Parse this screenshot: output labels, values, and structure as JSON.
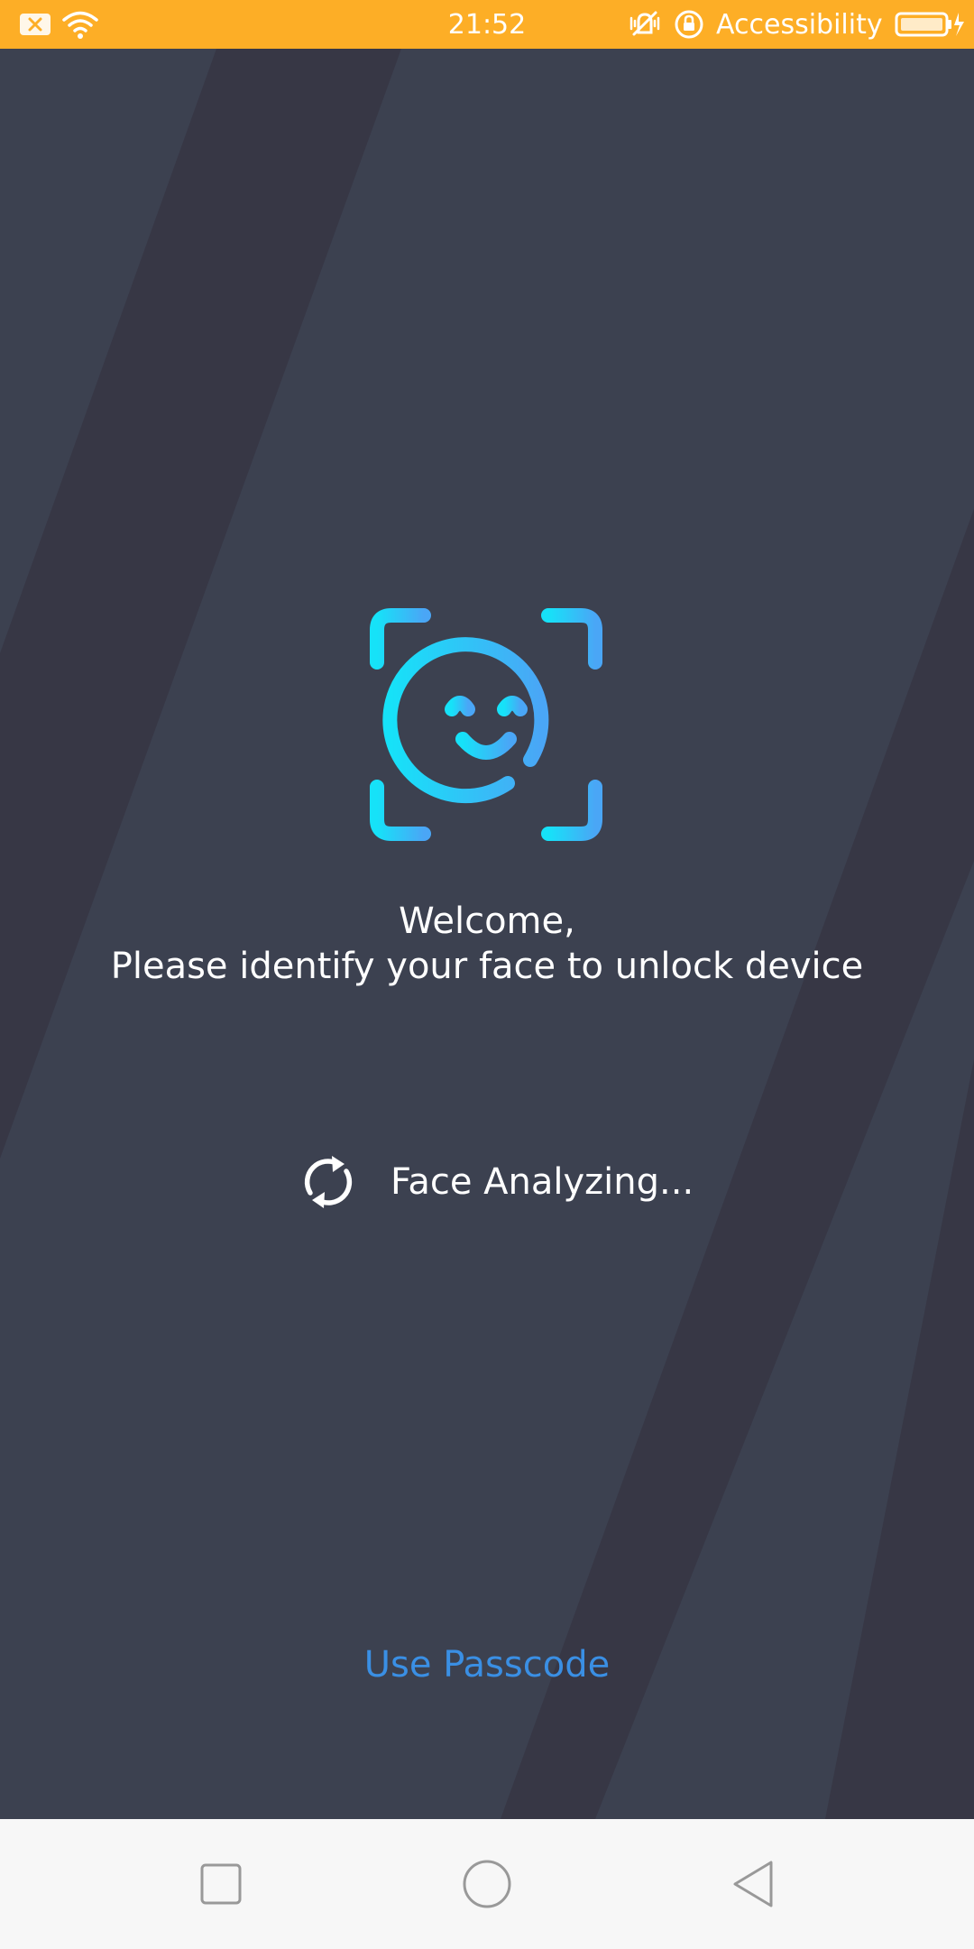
{
  "status_bar": {
    "time": "21:52",
    "right_label": "Accessibility",
    "background": "#fdae26"
  },
  "main": {
    "welcome_line1": "Welcome,",
    "welcome_line2": "Please identify your face to unlock device",
    "analyzing_label": "Face Analyzing...",
    "passcode_label": "Use Passcode"
  },
  "icons": {
    "face_scan": "face-scan-icon",
    "refresh": "refresh-icon"
  },
  "colors": {
    "background": "#3c4150",
    "band": "#373745",
    "accent_cyan": "#16e2f8",
    "accent_blue": "#4aa6f6",
    "link": "#3a8fe4",
    "nav_background": "#f7f7f7"
  }
}
